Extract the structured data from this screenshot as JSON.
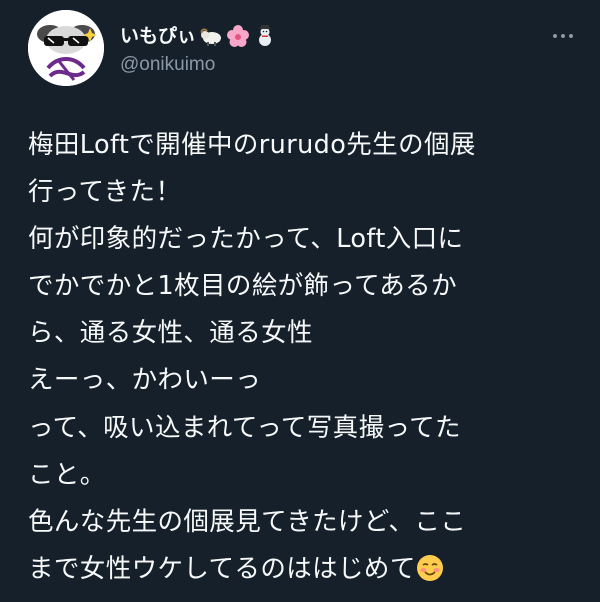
{
  "tweet": {
    "display_name": "いもぴぃ",
    "display_name_emojis": [
      "ram-emoji",
      "cherry-blossom-emoji",
      "snowman-emoji"
    ],
    "handle": "@onikuimo",
    "more_icon": "more-horizontal-icon",
    "body_lines": [
      "梅田Loftで開催中のrurudo先生の個展",
      "行ってきた！",
      "何が印象的だったかって、Loft入口に",
      "でかでかと1枚目の絵が飾ってあるか",
      "ら、通る女性、通る女性",
      "えーっ、かわいーっ",
      "って、吸い込まれてって写真撮ってた",
      "こと。",
      "色んな先生の個展見てきたけど、ここ",
      "まで女性ウケしてるのははじめて"
    ],
    "trailing_emoji": "smiling-face-emoji"
  },
  "colors": {
    "background": "#15202b",
    "text_primary": "#f7f9f9",
    "text_secondary": "#8b98a5"
  }
}
